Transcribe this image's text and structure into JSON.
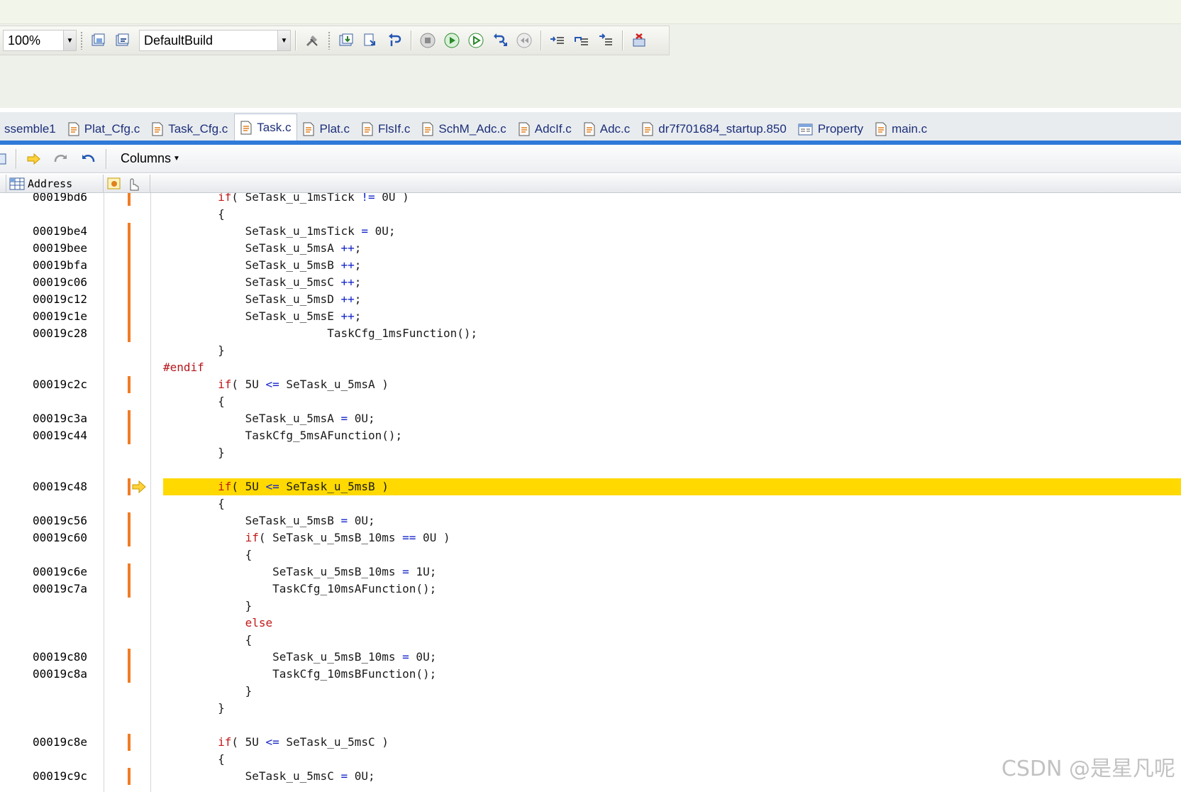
{
  "toolbar": {
    "zoom": "100%",
    "build_config": "DefaultBuild"
  },
  "tabs": [
    {
      "label": "ssemble1",
      "active": false
    },
    {
      "label": "Plat_Cfg.c",
      "active": false
    },
    {
      "label": "Task_Cfg.c",
      "active": false
    },
    {
      "label": "Task.c",
      "active": true
    },
    {
      "label": "Plat.c",
      "active": false
    },
    {
      "label": "FlsIf.c",
      "active": false
    },
    {
      "label": "SchM_Adc.c",
      "active": false
    },
    {
      "label": "AdcIf.c",
      "active": false
    },
    {
      "label": "Adc.c",
      "active": false
    },
    {
      "label": "dr7f701684_startup.850",
      "active": false
    },
    {
      "label": "Property",
      "active": false
    },
    {
      "label": "main.c",
      "active": false
    }
  ],
  "subbar": {
    "columns_label": "Columns"
  },
  "column_header": {
    "address_label": "Address"
  },
  "code": {
    "current_line_address": "00019c48",
    "lines": [
      {
        "addr": "00019bd6",
        "text": "        if( SeTask_u_1msTick != 0U )"
      },
      {
        "addr": "",
        "text": "        {"
      },
      {
        "addr": "00019be4",
        "text": "            SeTask_u_1msTick = 0U;"
      },
      {
        "addr": "00019bee",
        "text": "            SeTask_u_5msA ++;"
      },
      {
        "addr": "00019bfa",
        "text": "            SeTask_u_5msB ++;"
      },
      {
        "addr": "00019c06",
        "text": "            SeTask_u_5msC ++;"
      },
      {
        "addr": "00019c12",
        "text": "            SeTask_u_5msD ++;"
      },
      {
        "addr": "00019c1e",
        "text": "            SeTask_u_5msE ++;"
      },
      {
        "addr": "00019c28",
        "text": "                        TaskCfg_1msFunction();"
      },
      {
        "addr": "",
        "text": "        }"
      },
      {
        "addr": "",
        "text": "#endif"
      },
      {
        "addr": "00019c2c",
        "text": "        if( 5U <= SeTask_u_5msA )"
      },
      {
        "addr": "",
        "text": "        {"
      },
      {
        "addr": "00019c3a",
        "text": "            SeTask_u_5msA = 0U;"
      },
      {
        "addr": "00019c44",
        "text": "            TaskCfg_5msAFunction();"
      },
      {
        "addr": "",
        "text": "        }"
      },
      {
        "addr": "",
        "text": ""
      },
      {
        "addr": "00019c48",
        "text": "        if( 5U <= SeTask_u_5msB )"
      },
      {
        "addr": "",
        "text": "        {"
      },
      {
        "addr": "00019c56",
        "text": "            SeTask_u_5msB = 0U;"
      },
      {
        "addr": "00019c60",
        "text": "            if( SeTask_u_5msB_10ms == 0U )"
      },
      {
        "addr": "",
        "text": "            {"
      },
      {
        "addr": "00019c6e",
        "text": "                SeTask_u_5msB_10ms = 1U;"
      },
      {
        "addr": "00019c7a",
        "text": "                TaskCfg_10msAFunction();"
      },
      {
        "addr": "",
        "text": "            }"
      },
      {
        "addr": "",
        "text": "            else"
      },
      {
        "addr": "",
        "text": "            {"
      },
      {
        "addr": "00019c80",
        "text": "                SeTask_u_5msB_10ms = 0U;"
      },
      {
        "addr": "00019c8a",
        "text": "                TaskCfg_10msBFunction();"
      },
      {
        "addr": "",
        "text": "            }"
      },
      {
        "addr": "",
        "text": "        }"
      },
      {
        "addr": "",
        "text": ""
      },
      {
        "addr": "00019c8e",
        "text": "        if( 5U <= SeTask_u_5msC )"
      },
      {
        "addr": "",
        "text": "        {"
      },
      {
        "addr": "00019c9c",
        "text": "            SeTask_u_5msC = 0U;"
      }
    ]
  },
  "watermark": "CSDN @是星凡呢",
  "colors": {
    "highlight": "#ffd900",
    "breakpoint_marker": "#f07d23",
    "keyword": "#c01818",
    "operator": "#1325c8",
    "tab_accent": "#2f7ad8"
  }
}
